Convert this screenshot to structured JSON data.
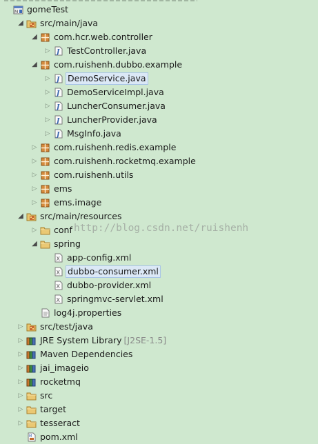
{
  "tree": [
    {
      "label": "gomeTest",
      "icon": "project",
      "expanded": true,
      "level": 0,
      "name": "project-gometest"
    },
    {
      "label": "src/main/java",
      "icon": "source-folder",
      "expanded": true,
      "level": 1,
      "name": "source-folder-main-java"
    },
    {
      "label": "com.hcr.web.controller",
      "icon": "package",
      "expanded": true,
      "level": 2,
      "name": "package-com-hcr-web-controller"
    },
    {
      "label": "TestController.java",
      "icon": "java-file",
      "expanded": false,
      "level": 3,
      "name": "file-testcontroller-java"
    },
    {
      "label": "com.ruishenh.dubbo.example",
      "icon": "package",
      "expanded": true,
      "level": 2,
      "name": "package-dubbo-example"
    },
    {
      "label": "DemoService.java",
      "icon": "java-file",
      "expanded": false,
      "level": 3,
      "selected": true,
      "name": "file-demoservice-java"
    },
    {
      "label": "DemoServiceImpl.java",
      "icon": "java-file",
      "expanded": false,
      "level": 3,
      "name": "file-demoserviceimpl-java"
    },
    {
      "label": "LuncherConsumer.java",
      "icon": "java-file",
      "expanded": false,
      "level": 3,
      "name": "file-luncherconsumer-java"
    },
    {
      "label": "LuncherProvider.java",
      "icon": "java-file",
      "expanded": false,
      "level": 3,
      "name": "file-luncherprovider-java"
    },
    {
      "label": "MsgInfo.java",
      "icon": "java-file",
      "expanded": false,
      "level": 3,
      "name": "file-msginfo-java"
    },
    {
      "label": "com.ruishenh.redis.example",
      "icon": "package",
      "expanded": false,
      "level": 2,
      "name": "package-redis-example"
    },
    {
      "label": "com.ruishenh.rocketmq.example",
      "icon": "package",
      "expanded": false,
      "level": 2,
      "name": "package-rocketmq-example"
    },
    {
      "label": "com.ruishenh.utils",
      "icon": "package",
      "expanded": false,
      "level": 2,
      "name": "package-utils"
    },
    {
      "label": "ems",
      "icon": "package",
      "expanded": false,
      "level": 2,
      "name": "package-ems"
    },
    {
      "label": "ems.image",
      "icon": "package",
      "expanded": false,
      "level": 2,
      "name": "package-ems-image"
    },
    {
      "label": "src/main/resources",
      "icon": "source-folder",
      "expanded": true,
      "level": 1,
      "name": "source-folder-main-resources"
    },
    {
      "label": "conf",
      "icon": "folder",
      "expanded": false,
      "level": 2,
      "name": "folder-conf"
    },
    {
      "label": "spring",
      "icon": "folder",
      "expanded": true,
      "level": 2,
      "name": "folder-spring"
    },
    {
      "label": "app-config.xml",
      "icon": "xml-file",
      "level": 3,
      "leaf": true,
      "name": "file-app-config-xml"
    },
    {
      "label": "dubbo-consumer.xml",
      "icon": "xml-file",
      "level": 3,
      "leaf": true,
      "selected": true,
      "name": "file-dubbo-consumer-xml"
    },
    {
      "label": "dubbo-provider.xml",
      "icon": "xml-file",
      "level": 3,
      "leaf": true,
      "name": "file-dubbo-provider-xml"
    },
    {
      "label": "springmvc-servlet.xml",
      "icon": "xml-file",
      "level": 3,
      "leaf": true,
      "name": "file-springmvc-servlet-xml"
    },
    {
      "label": "log4j.properties",
      "icon": "properties-file",
      "level": 2,
      "leaf": true,
      "name": "file-log4j-properties"
    },
    {
      "label": "src/test/java",
      "icon": "source-folder",
      "expanded": false,
      "level": 1,
      "name": "source-folder-test-java"
    },
    {
      "label": "JRE System Library",
      "decoration": "[J2SE-1.5]",
      "icon": "library",
      "expanded": false,
      "level": 1,
      "name": "library-jre-system"
    },
    {
      "label": "Maven Dependencies",
      "icon": "library",
      "expanded": false,
      "level": 1,
      "name": "library-maven-dependencies"
    },
    {
      "label": "jai_imageio",
      "icon": "library",
      "expanded": false,
      "level": 1,
      "name": "library-jai-imageio"
    },
    {
      "label": "rocketmq",
      "icon": "library",
      "expanded": false,
      "level": 1,
      "name": "library-rocketmq"
    },
    {
      "label": "src",
      "icon": "folder",
      "expanded": false,
      "level": 1,
      "name": "folder-src"
    },
    {
      "label": "target",
      "icon": "folder",
      "expanded": false,
      "level": 1,
      "name": "folder-target"
    },
    {
      "label": "tesseract",
      "icon": "folder",
      "expanded": false,
      "level": 1,
      "name": "folder-tesseract"
    },
    {
      "label": "pom.xml",
      "icon": "maven-pom",
      "level": 1,
      "leaf": true,
      "name": "file-pom-xml"
    }
  ],
  "watermark": "http://blog.csdn.net/ruishenh"
}
